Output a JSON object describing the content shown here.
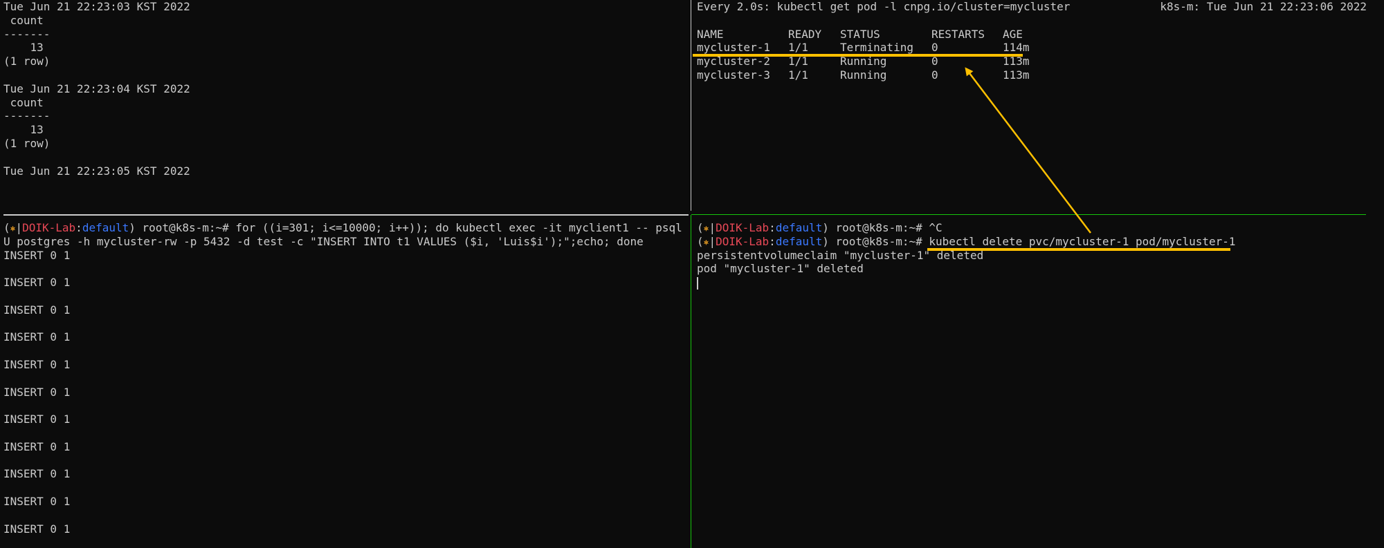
{
  "pane_top_left": {
    "lines": [
      "Tue Jun 21 22:23:03 KST 2022",
      " count",
      "-------",
      "    13",
      "(1 row)",
      "",
      "Tue Jun 21 22:23:04 KST 2022",
      " count",
      "-------",
      "    13",
      "(1 row)",
      "",
      "Tue Jun 21 22:23:05 KST 2022"
    ]
  },
  "pane_top_right": {
    "watch_command": "Every 2.0s: kubectl get pod -l cnpg.io/cluster=mycluster",
    "watch_host_time": "k8s-m: Tue Jun 21 22:23:06 2022",
    "columns": [
      "NAME",
      "READY",
      "STATUS",
      "RESTARTS",
      "AGE"
    ],
    "rows": [
      [
        "mycluster-1",
        "1/1",
        "Terminating",
        "0",
        "114m"
      ],
      [
        "mycluster-2",
        "1/1",
        "Running",
        "0",
        "113m"
      ],
      [
        "mycluster-3",
        "1/1",
        "Running",
        "0",
        "113m"
      ]
    ]
  },
  "prompt": {
    "open": "(",
    "gear": "⎈",
    "sep": "|",
    "cluster": "DOIK-Lab",
    "colon": ":",
    "namespace": "default",
    "close": ")",
    "user_host": " root@k8s-m:~# "
  },
  "pane_bottom_left": {
    "command_line1": "for ((i=301; i<=10000; i++)); do kubectl exec -it myclient1 -- psql -",
    "command_line2": "U postgres -h mycluster-rw -p 5432 -d test -c \"INSERT INTO t1 VALUES ($i, 'Luis$i');\";echo; done",
    "outputs": [
      "INSERT 0 1",
      "INSERT 0 1",
      "INSERT 0 1",
      "INSERT 0 1",
      "INSERT 0 1",
      "INSERT 0 1",
      "INSERT 0 1",
      "INSERT 0 1",
      "INSERT 0 1",
      "INSERT 0 1",
      "INSERT 0 1"
    ]
  },
  "pane_bottom_right": {
    "command1": "^C",
    "command2": "kubectl delete pvc/mycluster-1 pod/mycluster-1",
    "output1": "persistentvolumeclaim \"mycluster-1\" deleted",
    "output2": "pod \"mycluster-1\" deleted"
  },
  "colors": {
    "background": "#0c0c0c",
    "text": "#cccccc",
    "prompt_cluster": "#e74856",
    "prompt_namespace": "#3b78ff",
    "active_pane_border": "#16c60c",
    "annotation": "#ffc000"
  }
}
